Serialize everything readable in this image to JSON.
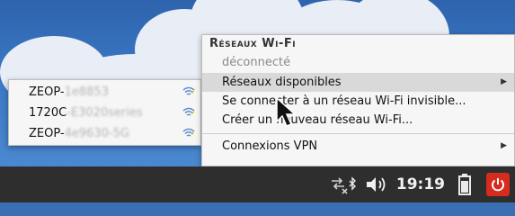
{
  "menu": {
    "header": "Réseaux Wi-Fi",
    "status": "déconnecté",
    "items": [
      {
        "label": "Réseaux disponibles",
        "has_submenu": true
      },
      {
        "label": "Se connecter à un réseau Wi-Fi invisible..."
      },
      {
        "label": "Créer un nouveau réseau Wi-Fi..."
      },
      {
        "label": "Connexions VPN",
        "has_submenu": true
      }
    ]
  },
  "submenu": {
    "networks": [
      {
        "prefix": "ZEOP-",
        "hidden": "1e8853"
      },
      {
        "prefix": "1720C",
        "hidden": "-E3020series"
      },
      {
        "prefix": "ZEOP-",
        "hidden": "4e9630-5G"
      }
    ]
  },
  "taskbar": {
    "clock": "19:19",
    "icons": [
      "network-disconnected-icon",
      "bluetooth-icon",
      "volume-icon",
      "battery-icon",
      "power-icon"
    ],
    "power_color": "#d62b1e"
  }
}
